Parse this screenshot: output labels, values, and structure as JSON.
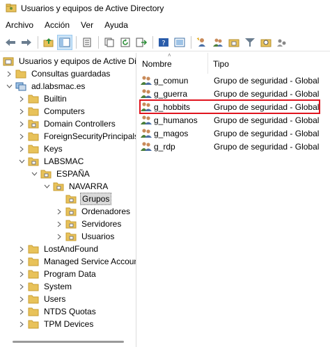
{
  "window": {
    "title": "Usuarios y equipos de Active Directory"
  },
  "menu": {
    "items": [
      "Archivo",
      "Acción",
      "Ver",
      "Ayuda"
    ]
  },
  "toolbar": {
    "buttons": [
      "back-icon",
      "forward-icon",
      "up-folder-icon",
      "console-tree-toggle-icon",
      "properties-icon",
      "copy-icon",
      "refresh-icon",
      "export-list-icon",
      "help-icon",
      "mmc-pane-icon",
      "new-user-icon",
      "new-group-icon",
      "new-ou-icon",
      "filter-icon",
      "find-icon",
      "add-to-group-icon"
    ]
  },
  "tree": {
    "root": "Usuarios y equipos de Active Directory",
    "saved_queries": "Consultas guardadas",
    "domain": "ad.labsmac.es",
    "items": {
      "builtin": "Builtin",
      "computers": "Computers",
      "domain_controllers": "Domain Controllers",
      "fsp": "ForeignSecurityPrincipals",
      "keys": "Keys",
      "labsmac": "LABSMAC",
      "espana": "ESPAÑA",
      "navarra": "NAVARRA",
      "grupos": "Grupos",
      "ordenadores": "Ordenadores",
      "servidores": "Servidores",
      "usuarios_ou": "Usuarios",
      "lostandfound": "LostAndFound",
      "msa": "Managed Service Accounts",
      "program_data": "Program Data",
      "system": "System",
      "users": "Users",
      "ntds_quotas": "NTDS Quotas",
      "tpm_devices": "TPM Devices"
    }
  },
  "list": {
    "columns": {
      "name": "Nombre",
      "type": "Tipo"
    },
    "rows": [
      {
        "name": "g_comun",
        "type": "Grupo de seguridad - Global"
      },
      {
        "name": "g_guerra",
        "type": "Grupo de seguridad - Global"
      },
      {
        "name": "g_hobbits",
        "type": "Grupo de seguridad - Global",
        "highlighted": true
      },
      {
        "name": "g_humanos",
        "type": "Grupo de seguridad - Global"
      },
      {
        "name": "g_magos",
        "type": "Grupo de seguridad - Global"
      },
      {
        "name": "g_rdp",
        "type": "Grupo de seguridad - Global"
      }
    ]
  },
  "colors": {
    "highlight_border": "#e0141e",
    "folder": "#e8c25a",
    "selection_bg": "#d9d9d9"
  }
}
